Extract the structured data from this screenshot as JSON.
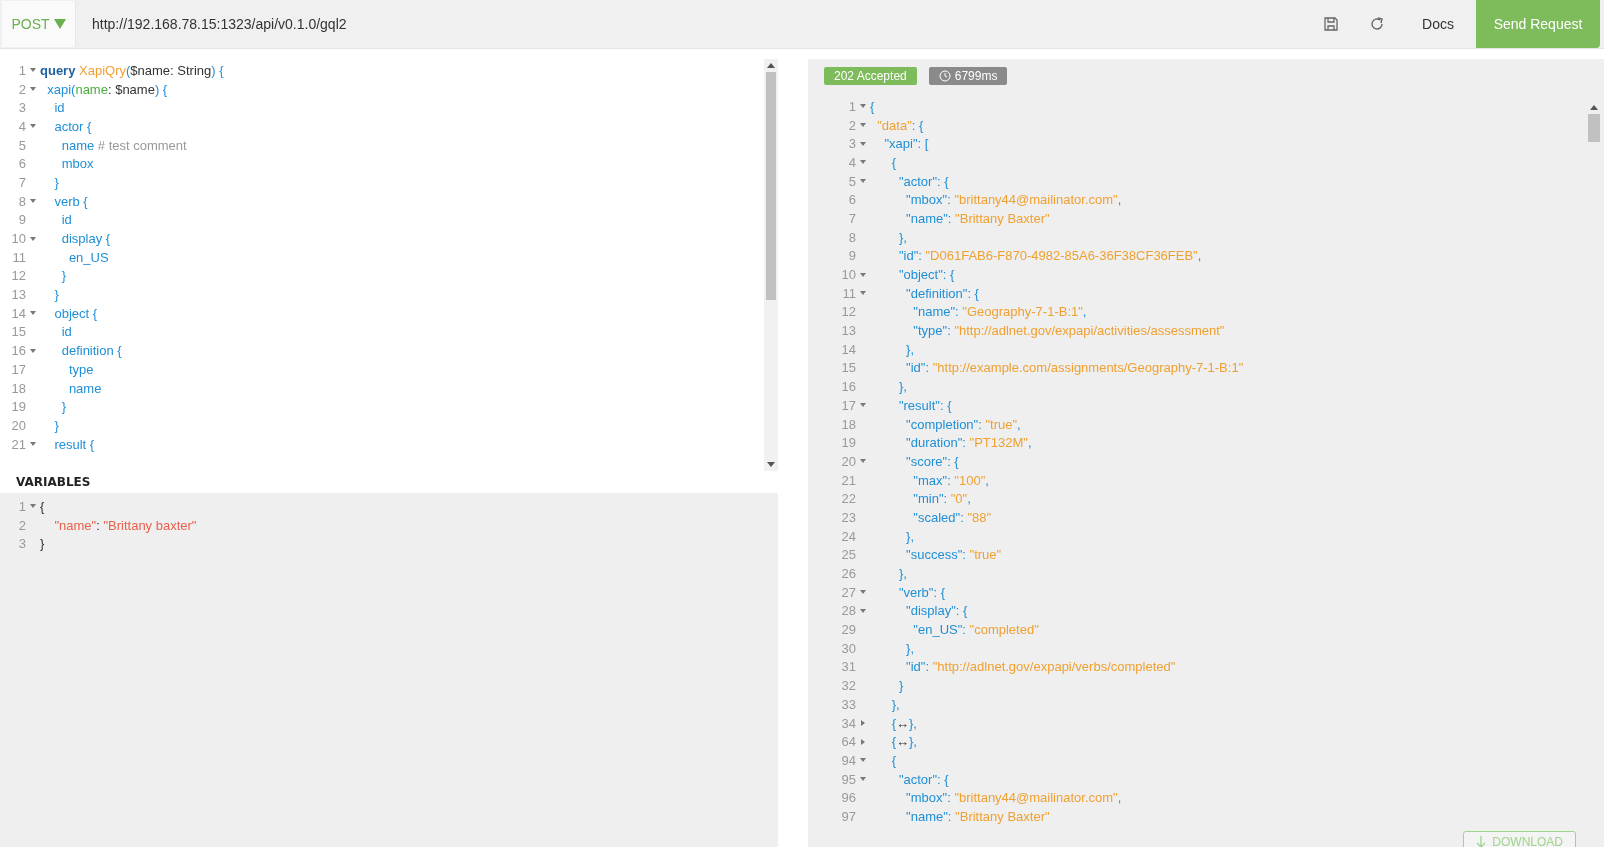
{
  "toolbar": {
    "method": "POST",
    "url": "http://192.168.78.15:1323/api/v0.1.0/gql2",
    "docs": "Docs",
    "send": "Send Request"
  },
  "query_editor": {
    "lines": [
      {
        "num": "1",
        "expanded": true,
        "tokens": [
          {
            "kind": "kw",
            "text": "query"
          },
          {
            "kind": "def",
            "text": " XapiQry"
          },
          {
            "kind": "punct",
            "text": "("
          },
          {
            "kind": "plain",
            "text": "$name: String"
          },
          {
            "kind": "punct",
            "text": ") {"
          }
        ]
      },
      {
        "num": "2",
        "expanded": true,
        "tokens": [
          {
            "kind": "prop",
            "text": "  xapi("
          },
          {
            "kind": "arg",
            "text": "name"
          },
          {
            "kind": "plain",
            "text": ": $name"
          },
          {
            "kind": "punct",
            "text": ") {"
          }
        ]
      },
      {
        "num": "3",
        "tokens": [
          {
            "kind": "prop",
            "text": "    id"
          }
        ]
      },
      {
        "num": "4",
        "expanded": true,
        "tokens": [
          {
            "kind": "prop",
            "text": "    actor {"
          }
        ]
      },
      {
        "num": "5",
        "tokens": [
          {
            "kind": "prop",
            "text": "      name"
          },
          {
            "kind": "comment",
            "text": " # test comment"
          }
        ]
      },
      {
        "num": "6",
        "tokens": [
          {
            "kind": "prop",
            "text": "      mbox"
          }
        ]
      },
      {
        "num": "7",
        "tokens": [
          {
            "kind": "punct",
            "text": "    }"
          }
        ]
      },
      {
        "num": "8",
        "expanded": true,
        "tokens": [
          {
            "kind": "prop",
            "text": "    verb {"
          }
        ]
      },
      {
        "num": "9",
        "tokens": [
          {
            "kind": "prop",
            "text": "      id"
          }
        ]
      },
      {
        "num": "10",
        "expanded": true,
        "tokens": [
          {
            "kind": "prop",
            "text": "      display {"
          }
        ]
      },
      {
        "num": "11",
        "tokens": [
          {
            "kind": "prop",
            "text": "        en_US"
          }
        ]
      },
      {
        "num": "12",
        "tokens": [
          {
            "kind": "punct",
            "text": "      }"
          }
        ]
      },
      {
        "num": "13",
        "tokens": [
          {
            "kind": "punct",
            "text": "    }"
          }
        ]
      },
      {
        "num": "14",
        "expanded": true,
        "tokens": [
          {
            "kind": "prop",
            "text": "    object {"
          }
        ]
      },
      {
        "num": "15",
        "tokens": [
          {
            "kind": "prop",
            "text": "      id"
          }
        ]
      },
      {
        "num": "16",
        "expanded": true,
        "tokens": [
          {
            "kind": "prop",
            "text": "      definition {"
          }
        ]
      },
      {
        "num": "17",
        "tokens": [
          {
            "kind": "prop",
            "text": "        type"
          }
        ]
      },
      {
        "num": "18",
        "tokens": [
          {
            "kind": "prop",
            "text": "        name"
          }
        ]
      },
      {
        "num": "19",
        "tokens": [
          {
            "kind": "punct",
            "text": "      }"
          }
        ]
      },
      {
        "num": "20",
        "tokens": [
          {
            "kind": "punct",
            "text": "    }"
          }
        ]
      },
      {
        "num": "21",
        "expanded": true,
        "tokens": [
          {
            "kind": "prop",
            "text": "    result {"
          }
        ]
      }
    ]
  },
  "variables": {
    "title": "VARIABLES",
    "lines": [
      {
        "num": "1",
        "expanded": true,
        "tokens": [
          {
            "kind": "plain",
            "text": "{"
          }
        ]
      },
      {
        "num": "2",
        "tokens": [
          {
            "kind": "var",
            "text": "    \"name\""
          },
          {
            "kind": "plain",
            "text": ": "
          },
          {
            "kind": "var",
            "text": "\"Brittany baxter\""
          }
        ]
      },
      {
        "num": "3",
        "tokens": [
          {
            "kind": "plain",
            "text": "}"
          }
        ]
      }
    ]
  },
  "response": {
    "status": "202 Accepted",
    "time": "6799ms",
    "download": "DOWNLOAD",
    "lines": [
      {
        "num": "1",
        "expanded": true,
        "tokens": [
          {
            "kind": "punct",
            "text": "{"
          }
        ]
      },
      {
        "num": "2",
        "expanded": true,
        "tokens": [
          {
            "kind": "string",
            "text": "  \"data\""
          },
          {
            "kind": "punct",
            "text": ": {"
          }
        ]
      },
      {
        "num": "3",
        "expanded": true,
        "tokens": [
          {
            "kind": "prop",
            "text": "    \"xapi\": ["
          }
        ]
      },
      {
        "num": "4",
        "expanded": true,
        "tokens": [
          {
            "kind": "punct",
            "text": "      {"
          }
        ]
      },
      {
        "num": "5",
        "expanded": true,
        "tokens": [
          {
            "kind": "prop",
            "text": "        \"actor\": {"
          }
        ]
      },
      {
        "num": "6",
        "tokens": [
          {
            "kind": "prop",
            "text": "          \"mbox\": "
          },
          {
            "kind": "string",
            "text": "\"brittany44@mailinator.com\""
          },
          {
            "kind": "punct",
            "text": ","
          }
        ]
      },
      {
        "num": "7",
        "tokens": [
          {
            "kind": "prop",
            "text": "          \"name\": "
          },
          {
            "kind": "string",
            "text": "\"Brittany Baxter\""
          }
        ]
      },
      {
        "num": "8",
        "tokens": [
          {
            "kind": "punct",
            "text": "        },"
          }
        ]
      },
      {
        "num": "9",
        "tokens": [
          {
            "kind": "prop",
            "text": "        \"id\": "
          },
          {
            "kind": "string",
            "text": "\"D061FAB6-F870-4982-85A6-36F38CF36FEB\""
          },
          {
            "kind": "punct",
            "text": ","
          }
        ]
      },
      {
        "num": "10",
        "expanded": true,
        "tokens": [
          {
            "kind": "prop",
            "text": "        \"object\": {"
          }
        ]
      },
      {
        "num": "11",
        "expanded": true,
        "tokens": [
          {
            "kind": "prop",
            "text": "          \"definition\": {"
          }
        ]
      },
      {
        "num": "12",
        "tokens": [
          {
            "kind": "prop",
            "text": "            \"name\": "
          },
          {
            "kind": "string",
            "text": "\"Geography-7-1-B:1\""
          },
          {
            "kind": "punct",
            "text": ","
          }
        ]
      },
      {
        "num": "13",
        "tokens": [
          {
            "kind": "prop",
            "text": "            \"type\": "
          },
          {
            "kind": "string",
            "text": "\"http://adlnet.gov/expapi/activities/assessment\""
          }
        ]
      },
      {
        "num": "14",
        "tokens": [
          {
            "kind": "punct",
            "text": "          },"
          }
        ]
      },
      {
        "num": "15",
        "tokens": [
          {
            "kind": "prop",
            "text": "          \"id\": "
          },
          {
            "kind": "string",
            "text": "\"http://example.com/assignments/Geography-7-1-B:1\""
          }
        ]
      },
      {
        "num": "16",
        "tokens": [
          {
            "kind": "punct",
            "text": "        },"
          }
        ]
      },
      {
        "num": "17",
        "expanded": true,
        "tokens": [
          {
            "kind": "prop",
            "text": "        \"result\": {"
          }
        ]
      },
      {
        "num": "18",
        "tokens": [
          {
            "kind": "prop",
            "text": "          \"completion\": "
          },
          {
            "kind": "string",
            "text": "\"true\""
          },
          {
            "kind": "punct",
            "text": ","
          }
        ]
      },
      {
        "num": "19",
        "tokens": [
          {
            "kind": "prop",
            "text": "          \"duration\": "
          },
          {
            "kind": "string",
            "text": "\"PT132M\""
          },
          {
            "kind": "punct",
            "text": ","
          }
        ]
      },
      {
        "num": "20",
        "expanded": true,
        "tokens": [
          {
            "kind": "prop",
            "text": "          \"score\": {"
          }
        ]
      },
      {
        "num": "21",
        "tokens": [
          {
            "kind": "prop",
            "text": "            \"max\": "
          },
          {
            "kind": "string",
            "text": "\"100\""
          },
          {
            "kind": "punct",
            "text": ","
          }
        ]
      },
      {
        "num": "22",
        "tokens": [
          {
            "kind": "prop",
            "text": "            \"min\": "
          },
          {
            "kind": "string",
            "text": "\"0\""
          },
          {
            "kind": "punct",
            "text": ","
          }
        ]
      },
      {
        "num": "23",
        "tokens": [
          {
            "kind": "prop",
            "text": "            \"scaled\": "
          },
          {
            "kind": "string",
            "text": "\"88\""
          }
        ]
      },
      {
        "num": "24",
        "tokens": [
          {
            "kind": "punct",
            "text": "          },"
          }
        ]
      },
      {
        "num": "25",
        "tokens": [
          {
            "kind": "prop",
            "text": "          \"success\": "
          },
          {
            "kind": "string",
            "text": "\"true\""
          }
        ]
      },
      {
        "num": "26",
        "tokens": [
          {
            "kind": "punct",
            "text": "        },"
          }
        ]
      },
      {
        "num": "27",
        "expanded": true,
        "tokens": [
          {
            "kind": "prop",
            "text": "        \"verb\": {"
          }
        ]
      },
      {
        "num": "28",
        "expanded": true,
        "tokens": [
          {
            "kind": "prop",
            "text": "          \"display\": {"
          }
        ]
      },
      {
        "num": "29",
        "tokens": [
          {
            "kind": "prop",
            "text": "            \"en_US\": "
          },
          {
            "kind": "string",
            "text": "\"completed\""
          }
        ]
      },
      {
        "num": "30",
        "tokens": [
          {
            "kind": "punct",
            "text": "          },"
          }
        ]
      },
      {
        "num": "31",
        "tokens": [
          {
            "kind": "prop",
            "text": "          \"id\": "
          },
          {
            "kind": "string",
            "text": "\"http://adlnet.gov/expapi/verbs/completed\""
          }
        ]
      },
      {
        "num": "32",
        "tokens": [
          {
            "kind": "punct",
            "text": "        }"
          }
        ]
      },
      {
        "num": "33",
        "tokens": [
          {
            "kind": "punct",
            "text": "      },"
          }
        ]
      },
      {
        "num": "34",
        "expanded": false,
        "tokens": [
          {
            "kind": "punct",
            "text": "      {"
          },
          {
            "kind": "plain",
            "text": "↔"
          },
          {
            "kind": "punct",
            "text": "},"
          }
        ]
      },
      {
        "num": "64",
        "expanded": false,
        "tokens": [
          {
            "kind": "punct",
            "text": "      {"
          },
          {
            "kind": "plain",
            "text": "↔"
          },
          {
            "kind": "punct",
            "text": "},"
          }
        ]
      },
      {
        "num": "94",
        "expanded": true,
        "tokens": [
          {
            "kind": "punct",
            "text": "      {"
          }
        ]
      },
      {
        "num": "95",
        "expanded": true,
        "tokens": [
          {
            "kind": "prop",
            "text": "        \"actor\": {"
          }
        ]
      },
      {
        "num": "96",
        "tokens": [
          {
            "kind": "prop",
            "text": "          \"mbox\": "
          },
          {
            "kind": "string",
            "text": "\"brittany44@mailinator.com\""
          },
          {
            "kind": "punct",
            "text": ","
          }
        ]
      },
      {
        "num": "97",
        "tokens": [
          {
            "kind": "prop",
            "text": "          \"name\": "
          },
          {
            "kind": "string",
            "text": "\"Brittany Baxter\""
          }
        ]
      }
    ]
  }
}
